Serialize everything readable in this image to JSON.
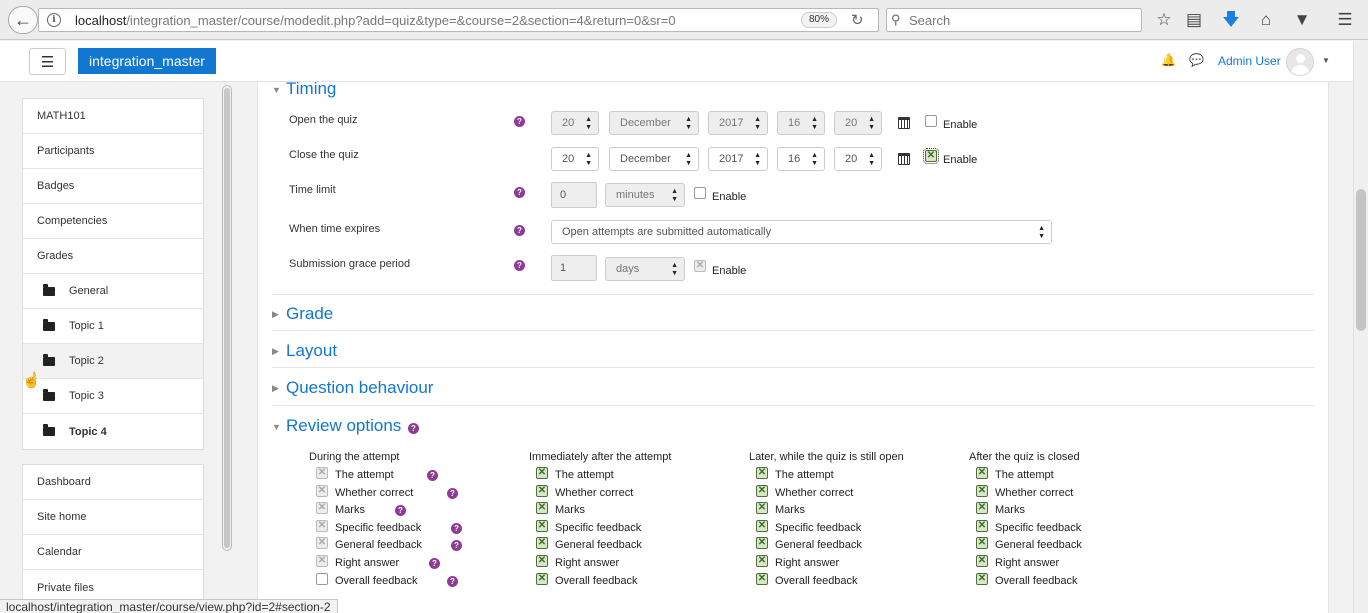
{
  "browser": {
    "url_host": "localhost",
    "url_path": "/integration_master/course/modedit.php?add=quiz&type=&course=2&section=4&return=0&sr=0",
    "zoom": "80%",
    "search_placeholder": "Search",
    "status_url": "localhost/integration_master/course/view.php?id=2#section-2"
  },
  "navbar": {
    "brand": "integration_master",
    "user_name": "Admin User"
  },
  "sidebar": {
    "course_items": [
      {
        "label": "MATH101"
      },
      {
        "label": "Participants"
      },
      {
        "label": "Badges"
      },
      {
        "label": "Competencies"
      },
      {
        "label": "Grades"
      },
      {
        "label": "General"
      },
      {
        "label": "Topic 1"
      },
      {
        "label": "Topic 2"
      },
      {
        "label": "Topic 3"
      },
      {
        "label": "Topic 4"
      }
    ],
    "site_items": [
      {
        "label": "Dashboard"
      },
      {
        "label": "Site home"
      },
      {
        "label": "Calendar"
      },
      {
        "label": "Private files"
      }
    ]
  },
  "timing": {
    "title": "Timing",
    "open_label": "Open the quiz",
    "close_label": "Close the quiz",
    "open": {
      "day": "20",
      "month": "December",
      "year": "2017",
      "hour": "16",
      "minute": "20",
      "enable": "Enable",
      "enabled": false
    },
    "close": {
      "day": "20",
      "month": "December",
      "year": "2017",
      "hour": "16",
      "minute": "20",
      "enable": "Enable",
      "enabled": true
    },
    "time_limit_label": "Time limit",
    "time_limit_value": "0",
    "time_limit_unit": "minutes",
    "time_limit_enable": "Enable",
    "when_expires_label": "When time expires",
    "when_expires_value": "Open attempts are submitted automatically",
    "grace_label": "Submission grace period",
    "grace_value": "1",
    "grace_unit": "days",
    "grace_enable": "Enable"
  },
  "sections": {
    "grade": "Grade",
    "layout": "Layout",
    "question_behaviour": "Question behaviour",
    "review_options": "Review options"
  },
  "review": {
    "columns": [
      "During the attempt",
      "Immediately after the attempt",
      "Later, while the quiz is still open",
      "After the quiz is closed"
    ],
    "items": [
      "The attempt",
      "Whether correct",
      "Marks",
      "Specific feedback",
      "General feedback",
      "Right answer",
      "Overall feedback"
    ]
  },
  "colors": {
    "brand": "#1177d1",
    "help": "#8e3b96",
    "checked": "#3f6a2a"
  }
}
